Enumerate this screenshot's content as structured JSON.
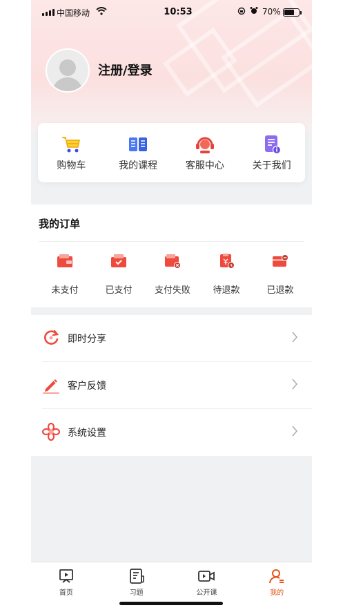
{
  "status_bar": {
    "carrier": "中国移动",
    "time": "10:53",
    "battery": "70%",
    "battery_level": 0.7,
    "icons": [
      "signal-icon",
      "wifi-icon",
      "rotation-lock-icon",
      "alarm-icon",
      "battery-icon"
    ]
  },
  "profile": {
    "login_label": "注册/登录",
    "avatar_icon": "default-avatar-icon"
  },
  "quick_links": [
    {
      "label": "购物车",
      "icon": "shopping-cart-icon"
    },
    {
      "label": "我的课程",
      "icon": "book-icon"
    },
    {
      "label": "客服中心",
      "icon": "headset-icon"
    },
    {
      "label": "关于我们",
      "icon": "info-doc-icon"
    }
  ],
  "orders": {
    "title": "我的订单",
    "items": [
      {
        "label": "未支付",
        "icon": "wallet-icon"
      },
      {
        "label": "已支付",
        "icon": "wallet-check-icon"
      },
      {
        "label": "支付失败",
        "icon": "wallet-fail-icon"
      },
      {
        "label": "待退款",
        "icon": "refund-pending-icon"
      },
      {
        "label": "已退款",
        "icon": "refunded-icon"
      }
    ]
  },
  "menu": [
    {
      "label": "即时分享",
      "icon": "share-refresh-icon"
    },
    {
      "label": "客户反馈",
      "icon": "pen-feedback-icon"
    },
    {
      "label": "系统设置",
      "icon": "flower-settings-icon"
    }
  ],
  "tabs": [
    {
      "label": "首页",
      "icon": "home-play-icon"
    },
    {
      "label": "习题",
      "icon": "exercise-icon"
    },
    {
      "label": "公开课",
      "icon": "video-icon"
    },
    {
      "label": "我的",
      "icon": "user-icon"
    }
  ],
  "colors": {
    "accent": "#e8541a",
    "brand_red": "#e8423b",
    "page_bg": "#eff1f3"
  }
}
